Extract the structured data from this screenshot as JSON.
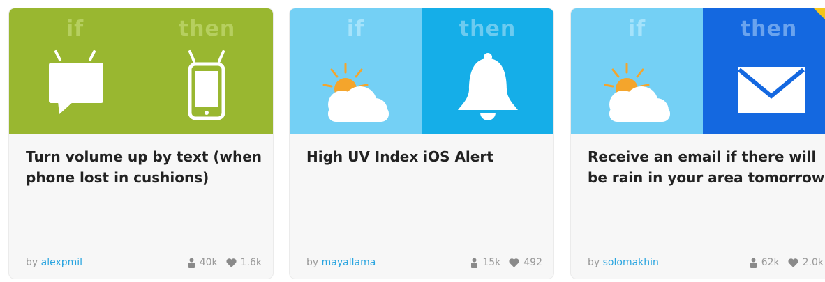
{
  "cards": [
    {
      "if_label": "if",
      "then_label": "then",
      "if_icon": "sms-icon",
      "then_icon": "android-phone-icon",
      "title": "Turn volume up by text (when phone lost in cushions)",
      "by": "by",
      "author": "alexpmil",
      "users": "40k",
      "favorites": "1.6k",
      "if_color": "#99b730",
      "then_color": "#99b730"
    },
    {
      "if_label": "if",
      "then_label": "then",
      "if_icon": "weather-icon",
      "then_icon": "bell-icon",
      "title": "High UV Index iOS Alert",
      "by": "by",
      "author": "mayallama",
      "users": "15k",
      "favorites": "492",
      "if_color": "#74d0f5",
      "then_color": "#15aee8"
    },
    {
      "if_label": "if",
      "then_label": "then",
      "if_icon": "weather-icon",
      "then_icon": "email-icon",
      "title": "Receive an email if there will be rain in your area tomorrow",
      "by": "by",
      "author": "solomakhin",
      "users": "62k",
      "favorites": "2.0k",
      "if_color": "#74d0f5",
      "then_color": "#1468e0"
    }
  ]
}
